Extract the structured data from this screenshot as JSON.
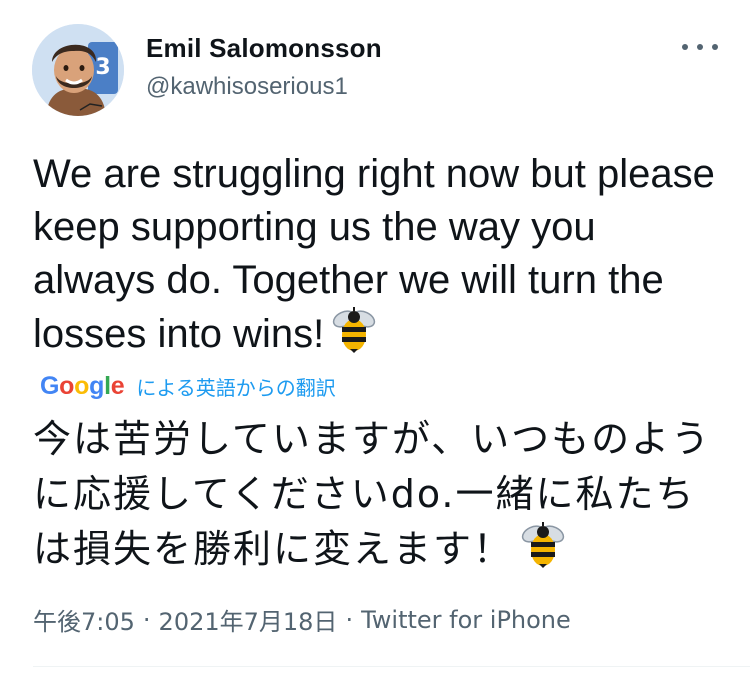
{
  "author": {
    "display_name": "Emil Salomonsson",
    "handle": "@kawhisoserious1",
    "avatar_badge_number": "3"
  },
  "tweet": {
    "text": "We are struggling right now but please keep supporting us the way you always do. Together we will turn the losses into wins!",
    "emoji": "bee-icon"
  },
  "translation": {
    "provider_logo_letters": [
      "G",
      "o",
      "o",
      "g",
      "l",
      "e"
    ],
    "label": "による英語からの翻訳",
    "text": "今は苦労していますが、いつものように応援してくださいdo.一緒に私たちは損失を勝利に変えます！"
  },
  "meta": {
    "time": "午後7:05",
    "separator": "·",
    "date": "2021年7月18日",
    "source": "Twitter for iPhone"
  },
  "colors": {
    "text": "#0f1419",
    "secondary": "#536471",
    "link": "#1d9bf0",
    "bee_yellow": "#f4b400",
    "bee_black": "#1a1a1a"
  }
}
